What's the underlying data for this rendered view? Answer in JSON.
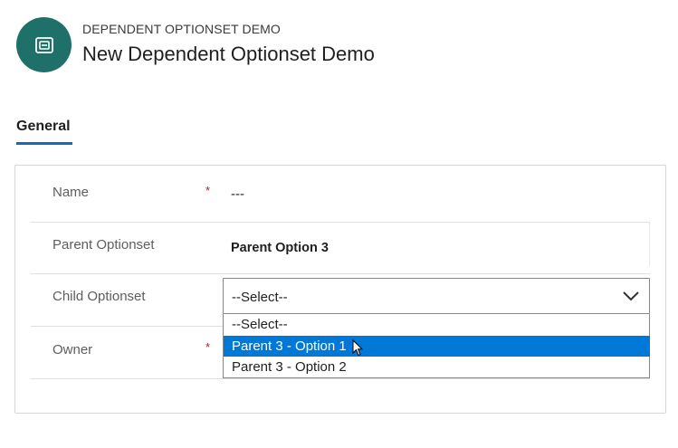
{
  "header": {
    "entity_type": "DEPENDENT OPTIONSET DEMO",
    "record_title": "New Dependent Optionset Demo",
    "icon": "entity-form-icon"
  },
  "tabs": [
    {
      "label": "General",
      "active": true
    }
  ],
  "form": {
    "fields": [
      {
        "label": "Name",
        "required": true,
        "required_mark": "*",
        "value": "---"
      },
      {
        "label": "Parent Optionset",
        "required": false,
        "value": "Parent Option 3"
      },
      {
        "label": "Child Optionset",
        "required": false,
        "value": "--Select--"
      },
      {
        "label": "Owner",
        "required": true,
        "required_mark": "*",
        "value": ""
      }
    ],
    "child_dropdown": {
      "open": true,
      "options": [
        "--Select--",
        "Parent 3 - Option 1",
        "Parent 3 - Option 2"
      ],
      "highlighted_index": 1
    }
  },
  "colors": {
    "accent": "#0f6cbd",
    "entity_icon_bg": "#1e7069",
    "highlight": "#0078d7",
    "required": "#a4262c"
  }
}
